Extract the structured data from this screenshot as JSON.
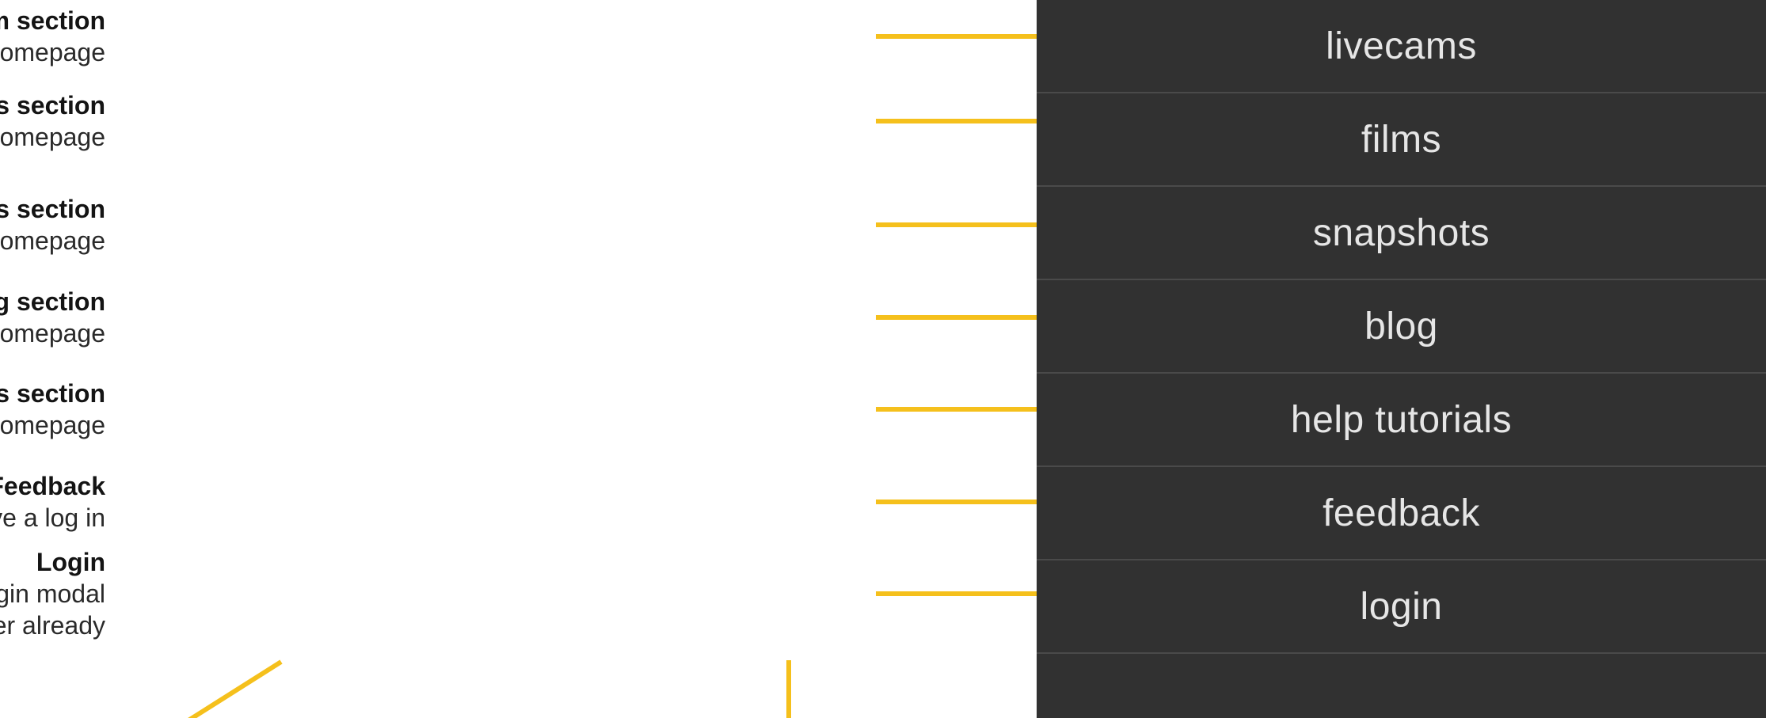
{
  "notes": [
    {
      "title": "Livecam section",
      "lines": [
        "Click to visit the livecam homepage"
      ]
    },
    {
      "title": "Films section",
      "lines": [
        "Click to visit the films homepage"
      ]
    },
    {
      "title": "Snapshots section",
      "lines": [
        "Click to visit the snapshots homepage"
      ]
    },
    {
      "title": "Blog section",
      "lines": [
        "Click to visit the blog homepage"
      ]
    },
    {
      "title": "Help tutorials section",
      "lines": [
        "Click to visit the video tutorials homepage"
      ]
    },
    {
      "title": "Feedback",
      "lines": [
        "Click to open the join modal if you don’t already have a log in"
      ]
    },
    {
      "title": "Login",
      "lines": [
        "Click to open the login modal",
        "or the join modal if you are not a member already"
      ]
    }
  ],
  "menu": {
    "items": [
      {
        "label": "livecams"
      },
      {
        "label": "films"
      },
      {
        "label": "snapshots"
      },
      {
        "label": "blog"
      },
      {
        "label": "help tutorials"
      },
      {
        "label": "feedback"
      },
      {
        "label": "login"
      }
    ]
  },
  "colors": {
    "accent": "#F5C01C",
    "panel": "#313131",
    "divider": "#4A4A4A",
    "menu_text": "#E6E6E6",
    "note_text": "#1C1C1C"
  },
  "icons": {
    "arrow": "right-arrow-icon"
  }
}
